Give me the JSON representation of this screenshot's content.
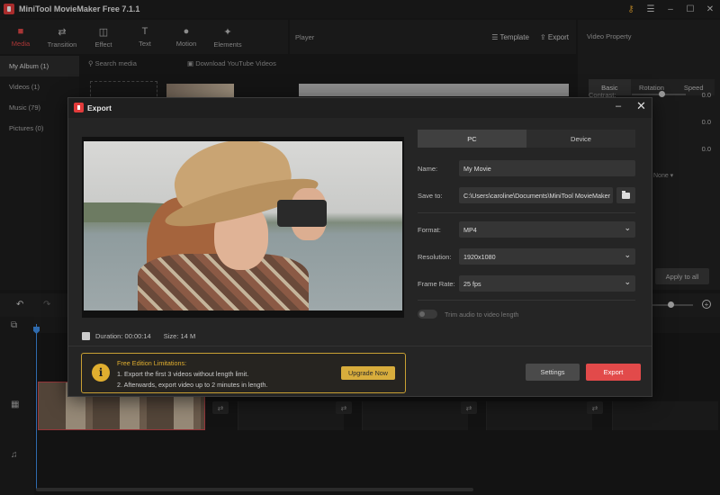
{
  "window": {
    "title": "MiniTool MovieMaker Free 7.1.1",
    "controls": [
      "key-icon",
      "menu-icon",
      "minimize-icon",
      "maximize-icon",
      "close-icon"
    ]
  },
  "toolbar": {
    "items": [
      {
        "label": "Media",
        "icon": "folder-icon"
      },
      {
        "label": "Transition",
        "icon": "transition-icon"
      },
      {
        "label": "Effect",
        "icon": "effect-icon"
      },
      {
        "label": "Text",
        "icon": "text-icon"
      },
      {
        "label": "Motion",
        "icon": "motion-icon"
      },
      {
        "label": "Elements",
        "icon": "elements-icon"
      }
    ]
  },
  "player": {
    "label": "Player",
    "template_label": "Template",
    "export_label": "Export"
  },
  "media": {
    "sidebar": [
      {
        "label": "My Album (1)"
      },
      {
        "label": "Videos (1)"
      },
      {
        "label": "Music (79)"
      },
      {
        "label": "Pictures (0)"
      }
    ],
    "search_placeholder": "Search media",
    "download_label": "Download YouTube Videos"
  },
  "video_property": {
    "title": "Video Property",
    "tabs": [
      "Basic",
      "Rotation",
      "Speed"
    ],
    "contrast_label": "Contrast:",
    "values": [
      "0.0",
      "0.0",
      "0.0"
    ],
    "none_label": "None",
    "apply_all": "Apply to all"
  },
  "dialog": {
    "title": "Export",
    "tabs": [
      "PC",
      "Device"
    ],
    "name_label": "Name:",
    "name_value": "My Movie",
    "save_label": "Save to:",
    "save_value": "C:\\Users\\caroline\\Documents\\MiniTool MovieMaker",
    "format_label": "Format:",
    "format_value": "MP4",
    "resolution_label": "Resolution:",
    "resolution_value": "1920x1080",
    "framerate_label": "Frame Rate:",
    "framerate_value": "25 fps",
    "trim_label": "Trim audio to video length",
    "duration_label": "Duration:",
    "duration_value": "00:00:14",
    "size_label": "Size:",
    "size_value": "14 M",
    "limit_title": "Free Edition Limitations:",
    "limit_line1": "1. Export the first 3 videos without length limit.",
    "limit_line2": "2. Afterwards, export video up to 2 minutes in length.",
    "upgrade_label": "Upgrade Now",
    "settings_label": "Settings",
    "export_label": "Export"
  },
  "colors": {
    "accent": "#e24a4a",
    "warning": "#e0ae2f",
    "playhead": "#3f8fe8"
  }
}
